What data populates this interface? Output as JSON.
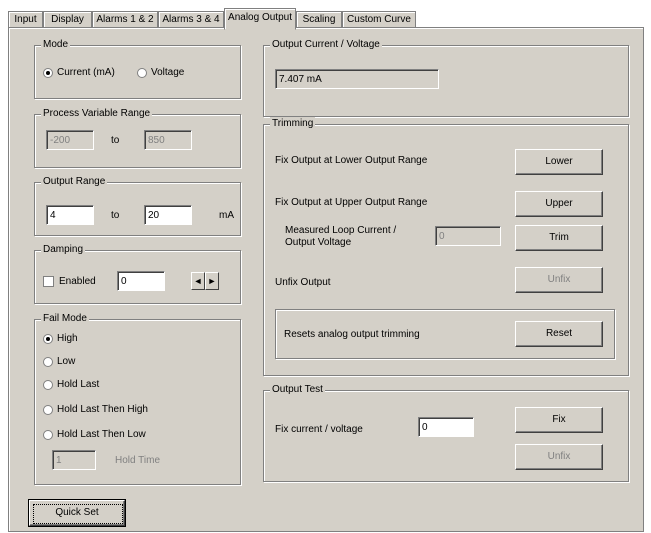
{
  "tabs": [
    "Input",
    "Display",
    "Alarms 1 & 2",
    "Alarms 3 & 4",
    "Analog Output",
    "Scaling",
    "Custom Curve"
  ],
  "active_tab": "Analog Output",
  "mode": {
    "title": "Mode",
    "options": [
      "Current (mA)",
      "Voltage"
    ],
    "selected": "Current (mA)"
  },
  "pv_range": {
    "title": "Process Variable Range",
    "low": "-200",
    "to": "to",
    "high": "850"
  },
  "output_range": {
    "title": "Output Range",
    "low": "4",
    "to": "to",
    "high": "20",
    "unit": "mA"
  },
  "damping": {
    "title": "Damping",
    "enabled_label": "Enabled",
    "enabled": false,
    "value": "0",
    "left": "◄",
    "right": "►"
  },
  "fail_mode": {
    "title": "Fail Mode",
    "options": [
      "High",
      "Low",
      "Hold Last",
      "Hold Last Then High",
      "Hold Last Then Low"
    ],
    "selected": "High",
    "hold_time_value": "1",
    "hold_time_label": "Hold Time"
  },
  "output_cv": {
    "title": "Output Current / Voltage",
    "value": "7.407 mA"
  },
  "trimming": {
    "title": "Trimming",
    "lower_label": "Fix Output at Lower Output Range",
    "lower_btn": "Lower",
    "upper_label": "Fix Output at Upper Output Range",
    "upper_btn": "Upper",
    "measured_label_1": "Measured Loop Current /",
    "measured_label_2": "Output Voltage",
    "measured_value": "0",
    "trim_btn": "Trim",
    "unfix_label": "Unfix Output",
    "unfix_btn": "Unfix",
    "reset_label": "Resets analog output trimming",
    "reset_btn": "Reset"
  },
  "output_test": {
    "title": "Output Test",
    "fix_label": "Fix current / voltage",
    "value": "0",
    "fix_btn": "Fix",
    "unfix_btn": "Unfix"
  },
  "quick_set": "Quick Set"
}
